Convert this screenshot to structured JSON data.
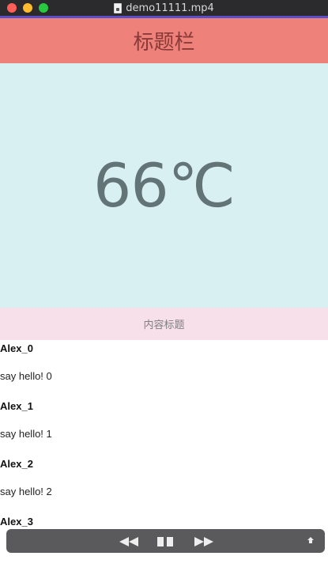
{
  "window": {
    "title": "demo11111.mp4"
  },
  "header": {
    "title": "标题栏"
  },
  "temperature": {
    "value": "66℃"
  },
  "content": {
    "title": "内容标题"
  },
  "list": {
    "items": [
      {
        "name": "Alex_0",
        "message": "say hello!  0"
      },
      {
        "name": "Alex_1",
        "message": "say hello!  1"
      },
      {
        "name": "Alex_2",
        "message": "say hello!  2"
      },
      {
        "name": "Alex_3",
        "message": ""
      }
    ]
  },
  "icons": {
    "file": "video-file-icon",
    "rewind": "rewind-icon",
    "pause": "pause-icon",
    "forward": "fast-forward-icon",
    "share": "share-icon"
  },
  "colors": {
    "header_bg": "#ee8179",
    "temp_bg": "#d9f0f3",
    "content_title_bg": "#f7e0ea",
    "accent_line": "#5a4fc9"
  }
}
